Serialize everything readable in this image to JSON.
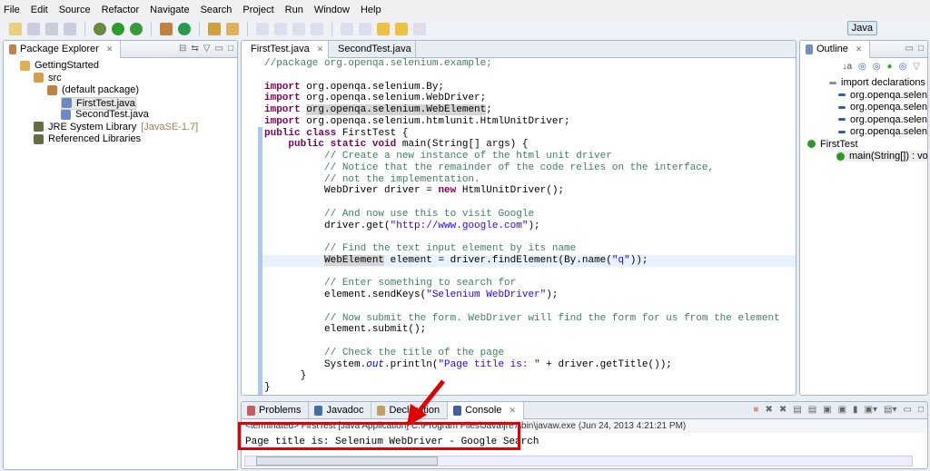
{
  "menu": [
    "File",
    "Edit",
    "Source",
    "Refactor",
    "Navigate",
    "Search",
    "Project",
    "Run",
    "Window",
    "Help"
  ],
  "perspective": "Java",
  "package_explorer": {
    "title": "Package Explorer",
    "items": [
      {
        "label": "GettingStarted",
        "extra": "",
        "icon": "project-icon",
        "indent": 0
      },
      {
        "label": "src",
        "extra": "",
        "icon": "source-folder-icon",
        "indent": 1
      },
      {
        "label": "(default package)",
        "extra": "",
        "icon": "package-icon",
        "indent": 2
      },
      {
        "label": "FirstTest.java",
        "extra": "",
        "icon": "java-file-icon",
        "indent": 3
      },
      {
        "label": "SecondTest.java",
        "extra": "",
        "icon": "java-file-icon",
        "indent": 3
      },
      {
        "label": "JRE System Library",
        "extra": "[JavaSE-1.7]",
        "icon": "library-icon",
        "indent": 1
      },
      {
        "label": "Referenced Libraries",
        "extra": "",
        "icon": "library-icon",
        "indent": 1
      }
    ]
  },
  "editor": {
    "tabs": [
      "FirstTest.java",
      "SecondTest.java"
    ],
    "active_tab": 0,
    "highlight_line": 17,
    "lines": [
      [
        [
          "cm",
          "//package org.openqa.selenium.example;"
        ]
      ],
      [],
      [
        [
          "kw",
          "import"
        ],
        [
          "p",
          " org.openqa.selenium.By;"
        ]
      ],
      [
        [
          "kw",
          "import"
        ],
        [
          "p",
          " org.openqa.selenium.WebDriver;"
        ]
      ],
      [
        [
          "kw",
          "import"
        ],
        [
          "p",
          " "
        ],
        [
          "occ",
          "org.openqa.selenium.WebElement"
        ],
        [
          "p",
          ";"
        ]
      ],
      [
        [
          "kw",
          "import"
        ],
        [
          "p",
          " org.openqa.selenium.htmlunit.HtmlUnitDriver;"
        ]
      ],
      [
        [
          "kw",
          "public"
        ],
        [
          "p",
          " "
        ],
        [
          "kw",
          "class"
        ],
        [
          "p",
          " FirstTest {"
        ]
      ],
      [
        [
          "p",
          "    "
        ],
        [
          "kw",
          "public"
        ],
        [
          "p",
          " "
        ],
        [
          "kw",
          "static"
        ],
        [
          "p",
          " "
        ],
        [
          "kw",
          "void"
        ],
        [
          "p",
          " main(String[] args) {"
        ]
      ],
      [
        [
          "cm",
          "          // Create a new instance of the html unit driver"
        ]
      ],
      [
        [
          "cm",
          "          // Notice that the remainder of the code relies on the interface,"
        ]
      ],
      [
        [
          "cm",
          "          // not the implementation."
        ]
      ],
      [
        [
          "p",
          "          WebDriver driver = "
        ],
        [
          "kw",
          "new"
        ],
        [
          "p",
          " HtmlUnitDriver();"
        ]
      ],
      [],
      [
        [
          "cm",
          "          // And now use this to visit Google"
        ]
      ],
      [
        [
          "p",
          "          driver.get("
        ],
        [
          "str",
          "\"http://www.google.com\""
        ],
        [
          "p",
          ");"
        ]
      ],
      [],
      [
        [
          "cm",
          "          // Find the text input element by its name"
        ]
      ],
      [
        [
          "p",
          "          "
        ],
        [
          "occ",
          "WebElement"
        ],
        [
          "p",
          " element = driver.findElement(By.name("
        ],
        [
          "str",
          "\"q\""
        ],
        [
          "p",
          "));"
        ]
      ],
      [],
      [
        [
          "cm",
          "          // Enter something to search for"
        ]
      ],
      [
        [
          "p",
          "          element.sendKeys("
        ],
        [
          "str",
          "\"Selenium WebDriver\""
        ],
        [
          "p",
          ");"
        ]
      ],
      [],
      [
        [
          "cm",
          "          // Now submit the form. WebDriver will find the form for us from the element"
        ]
      ],
      [
        [
          "p",
          "          element.submit();"
        ]
      ],
      [],
      [
        [
          "cm",
          "          // Check the title of the page"
        ]
      ],
      [
        [
          "p",
          "          System."
        ],
        [
          "fld",
          "out"
        ],
        [
          "p",
          ".println("
        ],
        [
          "str",
          "\"Page title is: \""
        ],
        [
          "p",
          " + driver.getTitle());"
        ]
      ],
      [
        [
          "p",
          "      }"
        ]
      ],
      [
        [
          "p",
          "}"
        ]
      ]
    ]
  },
  "outline": {
    "title": "Outline",
    "items": [
      {
        "label": "import declarations",
        "indent": 0
      },
      {
        "label": "org.openqa.seleniu",
        "indent": 1
      },
      {
        "label": "org.openqa.seleniu",
        "indent": 1
      },
      {
        "label": "org.openqa.seleniu",
        "indent": 1
      },
      {
        "label": "org.openqa.seleniu",
        "indent": 1
      },
      {
        "label": "FirstTest",
        "indent": 0
      },
      {
        "label": "main(String[]) : void",
        "indent": 1
      }
    ]
  },
  "bottom": {
    "tabs": [
      "Problems",
      "Javadoc",
      "Declaration",
      "Console"
    ],
    "active_tab": 3,
    "console_header": "<terminated> FirstTest [Java Application] C:\\Program Files\\Java\\jre7\\bin\\javaw.exe (Jun 24, 2013 4:21:21 PM)",
    "console_output": "Page title is: Selenium WebDriver - Google Search"
  },
  "colors": {
    "annotation": "#e00000"
  }
}
